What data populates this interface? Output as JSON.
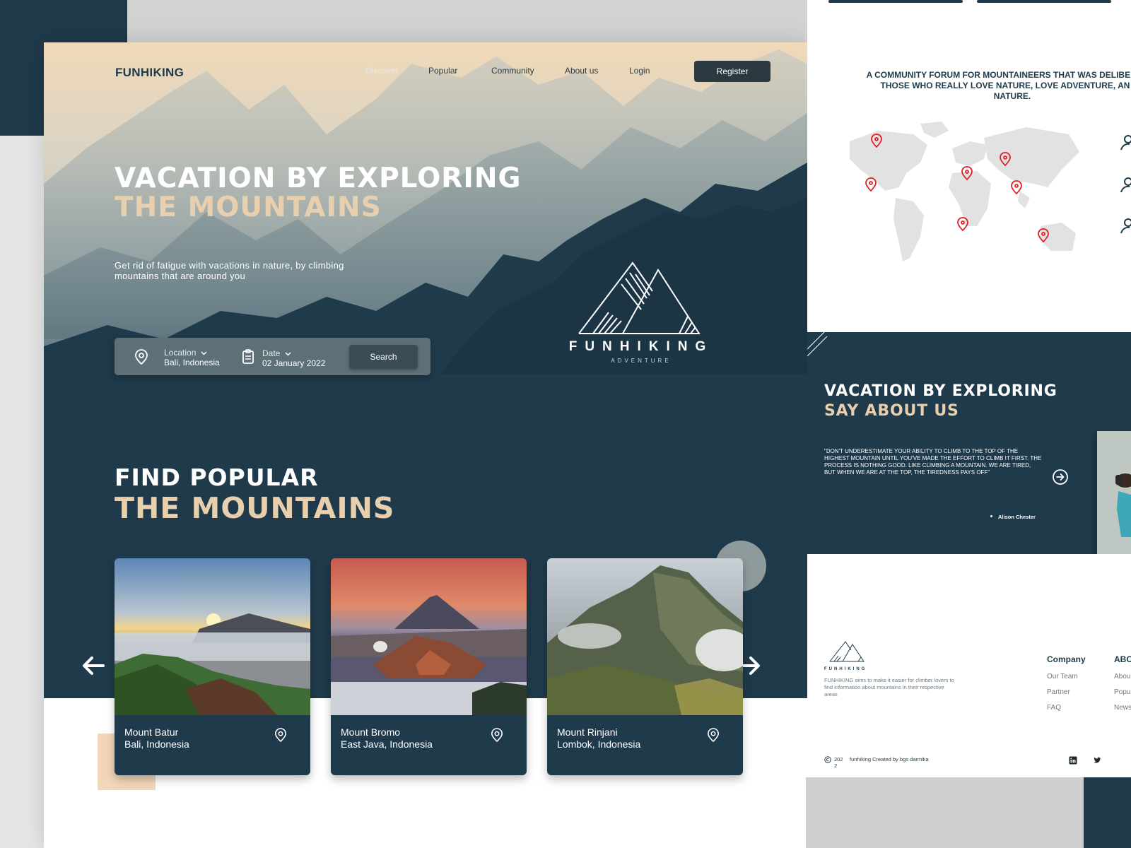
{
  "nav": {
    "brand": "FUNHIKING",
    "links": [
      {
        "label": "Discover",
        "active": true
      },
      {
        "label": "Popular",
        "active": false
      },
      {
        "label": "Community",
        "active": false
      },
      {
        "label": "About us",
        "active": false
      },
      {
        "label": "Login",
        "active": false
      }
    ],
    "register_label": "Register"
  },
  "hero": {
    "title_line1": "VACATION BY EXPLORING",
    "title_line2": "THE MOUNTAINS",
    "subtitle": "Get rid of fatigue with vacations in nature, by climbing mountains that are around you"
  },
  "search": {
    "location_label": "Location",
    "location_value": "Bali, Indonesia",
    "date_label": "Date",
    "date_value": "02 January 2022",
    "button_label": "Search"
  },
  "logo": {
    "name": "FUNHIKING",
    "tagline": "ADVENTURE"
  },
  "popular": {
    "title_line1": "FIND POPULAR",
    "title_line2": "THE MOUNTAINS",
    "cards": [
      {
        "name": "Mount Batur",
        "location": "Bali, Indonesia"
      },
      {
        "name": "Mount Bromo",
        "location": "East Java, Indonesia"
      },
      {
        "name": "Mount Rinjani",
        "location": "Lombok, Indonesia"
      }
    ]
  },
  "community": {
    "text": "A COMMUNITY FORUM FOR MOUNTAINEERS THAT WAS DELIBE UNITE THOSE WHO REALLY LOVE NATURE, LOVE ADVENTURE, AN OF NATURE."
  },
  "about": {
    "title_line1": "VACATION BY EXPLORING",
    "title_line2": "SAY ABOUT US",
    "quote": "\"DON'T UNDERESTIMATE YOUR ABILITY TO CLIMB TO THE TOP OF THE HIGHEST MOUNTAIN UNTIL YOU'VE MADE THE EFFORT TO CLIMB IT FIRST. THE PROCESS IS NOTHING GOOD. LIKE CLIMBING A MOUNTAIN. WE ARE TIRED, BUT WHEN WE ARE AT THE TOP, THE TIREDNESS PAYS OFF\"",
    "author": "Alison Chester"
  },
  "footer": {
    "logo_name": "FUNHIKING",
    "description": "FUNHIKING aims to make it easier for climber lovers to find information about mountains in their respective areas",
    "company_title": "Company",
    "company_links": [
      "Our Team",
      "Partner",
      "FAQ"
    ],
    "about_title": "ABO",
    "about_links": [
      "Abou",
      "Popu",
      "News"
    ],
    "copyright_year": "202 2",
    "credit": "funhiking Created by bgs darmika"
  },
  "colors": {
    "teal": "#1f3a4b",
    "beige": "#e8cfae",
    "pin_red": "#e0202a"
  }
}
